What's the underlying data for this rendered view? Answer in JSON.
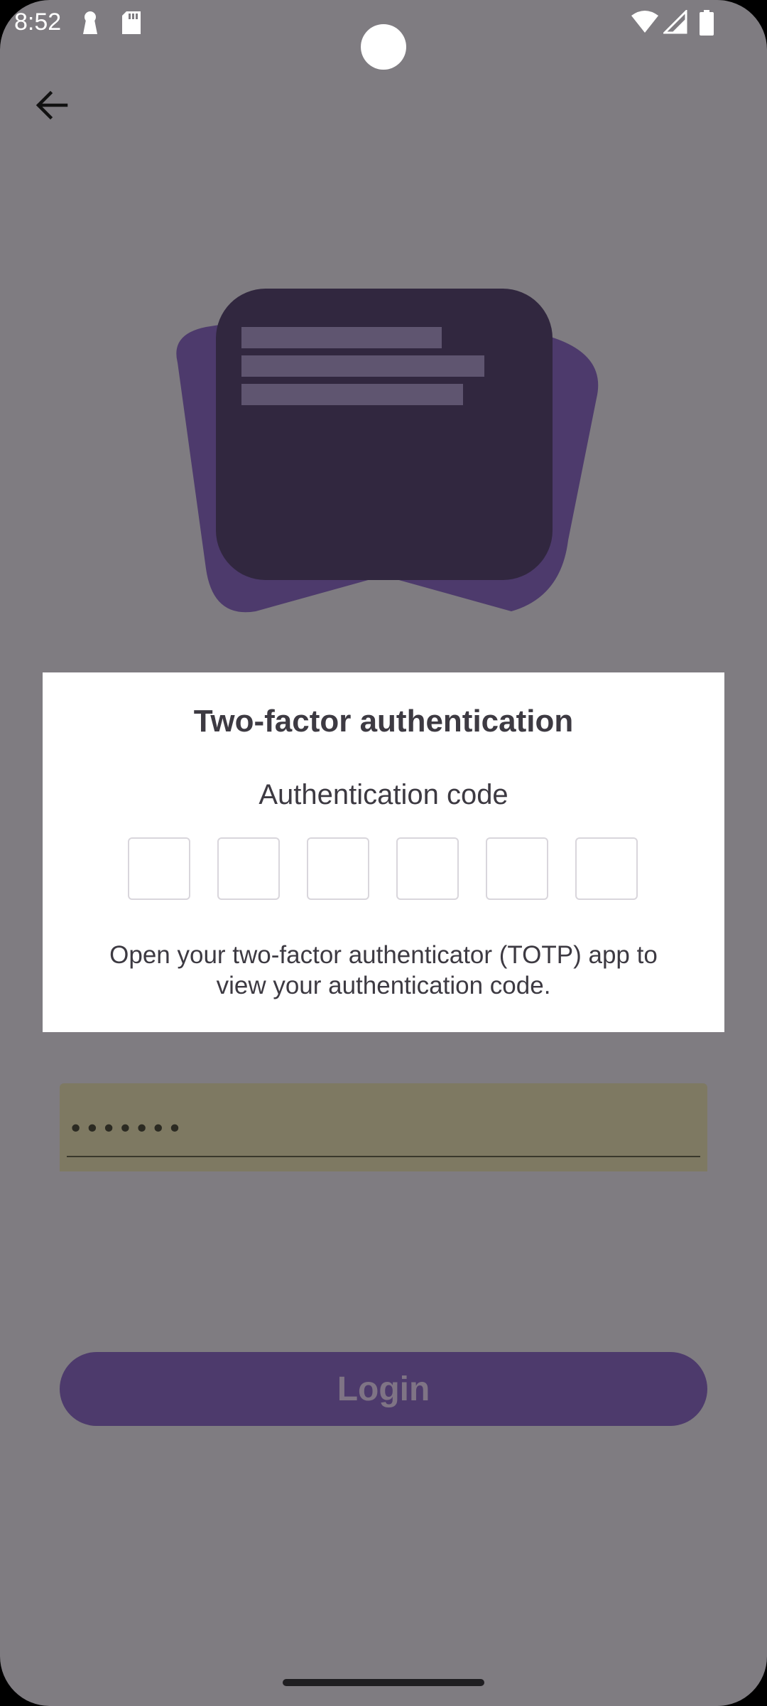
{
  "status_bar": {
    "time": "8:52",
    "icons": [
      "keyhole-icon",
      "sd-card-icon",
      "wifi-icon",
      "signal-icon",
      "battery-icon"
    ]
  },
  "header": {
    "back_icon": "arrow-left-icon"
  },
  "illustration": {
    "icon": "stacked-cards-illustration"
  },
  "login_form": {
    "password_value": "•••••••",
    "login_label": "Login"
  },
  "dialog": {
    "title": "Two-factor authentication",
    "code_label": "Authentication code",
    "code_digits": [
      "",
      "",
      "",
      "",
      "",
      ""
    ],
    "hint": "Open your two-factor authenticator (TOTP) app to view your authentication code."
  },
  "colors": {
    "scrim_background": "#7f7c81",
    "accent_purple": "#4d3a6c",
    "dialog_background": "#ffffff",
    "text_dark": "#3d3a42"
  }
}
